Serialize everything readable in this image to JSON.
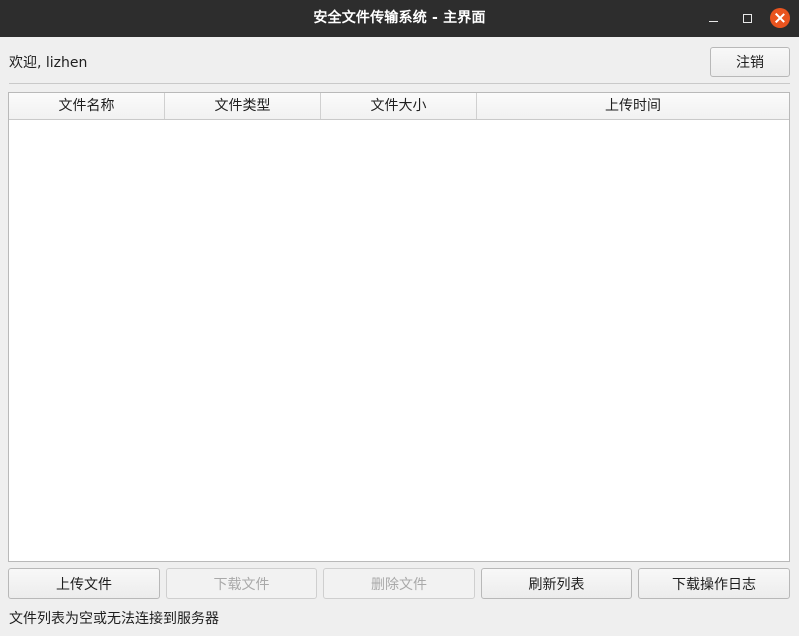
{
  "window": {
    "title": "安全文件传输系统 - 主界面",
    "controls": {
      "minimize": "minimize-icon",
      "maximize": "maximize-icon",
      "close": "close-icon",
      "close_color": "#e9541f"
    }
  },
  "header": {
    "welcome_text": "欢迎, lizhen",
    "logout_label": "注销"
  },
  "table": {
    "columns": [
      "文件名称",
      "文件类型",
      "文件大小",
      "上传时间"
    ],
    "rows": []
  },
  "actions": {
    "upload_label": "上传文件",
    "download_label": "下载文件",
    "delete_label": "删除文件",
    "refresh_label": "刷新列表",
    "download_log_label": "下载操作日志"
  },
  "status": {
    "message": "文件列表为空或无法连接到服务器"
  }
}
